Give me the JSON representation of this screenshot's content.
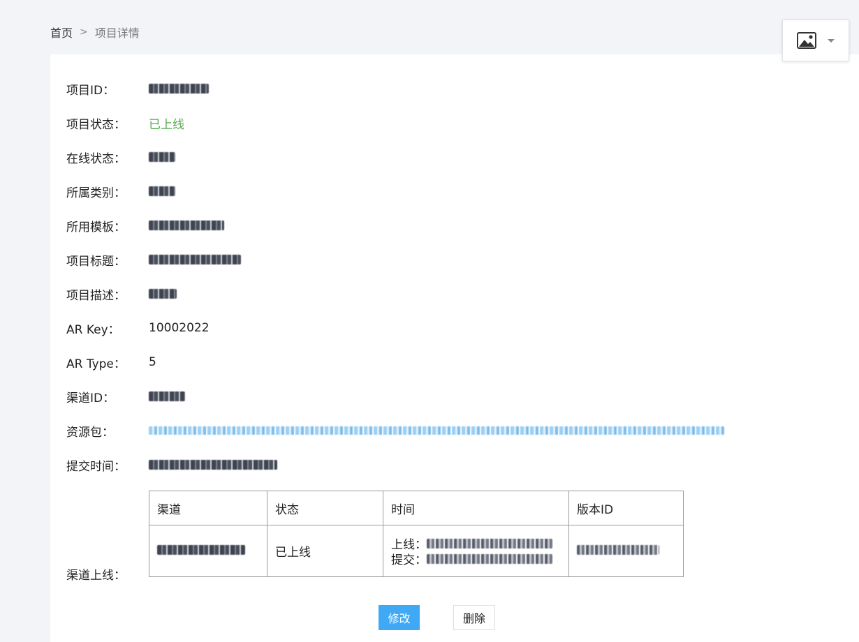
{
  "breadcrumb": {
    "home": "首页",
    "separator": ">",
    "current": "项目详情"
  },
  "image_widget": {
    "icon": "image-icon",
    "dropdown_icon": "caret-down-icon"
  },
  "fields": [
    {
      "label": "项目ID：",
      "value": "",
      "redacted": true
    },
    {
      "label": "项目状态：",
      "value": "已上线",
      "color": "#52a94b"
    },
    {
      "label": "在线状态：",
      "value": "",
      "redacted": true
    },
    {
      "label": "所属类别：",
      "value": "",
      "redacted": true
    },
    {
      "label": "所用模板：",
      "value": "",
      "redacted": true
    },
    {
      "label": "项目标题：",
      "value": "",
      "redacted": true
    },
    {
      "label": "项目描述：",
      "value": "",
      "redacted": true
    },
    {
      "label": "AR Key：",
      "value": "10002022"
    },
    {
      "label": "AR Type：",
      "value": "5"
    },
    {
      "label": "渠道ID：",
      "value": "",
      "redacted": true
    },
    {
      "label": "资源包：",
      "value": "",
      "redacted": true,
      "link": true
    },
    {
      "label": "提交时间：",
      "value": "",
      "redacted": true
    }
  ],
  "channels": {
    "label": "渠道上线：",
    "headers": [
      "渠道",
      "状态",
      "时间",
      "版本ID"
    ],
    "rows": [
      {
        "status": "已上线",
        "online_prefix": "上线：",
        "submit_prefix": "提交："
      }
    ]
  },
  "actions": {
    "edit": "修改",
    "delete": "删除",
    "edit_color": "#3fa9f5"
  }
}
